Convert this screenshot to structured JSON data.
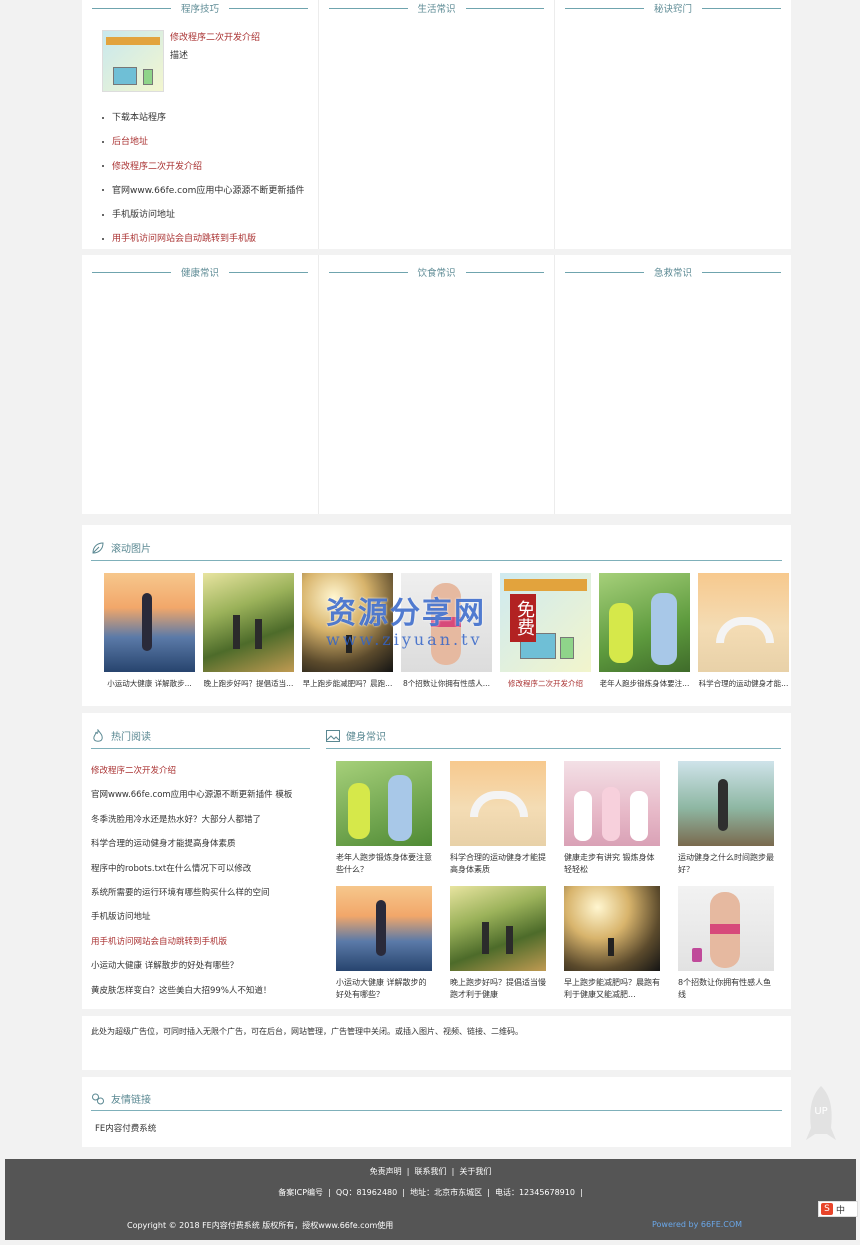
{
  "top_panel": {
    "columns": [
      {
        "title": "程序技巧"
      },
      {
        "title": "生活常识"
      },
      {
        "title": "秘诀窍门"
      }
    ],
    "featured": {
      "title": "修改程序二次开发介绍",
      "desc": "描述"
    },
    "links": [
      {
        "text": "下载本站程序",
        "red": false
      },
      {
        "text": "后台地址",
        "red": true
      },
      {
        "text": "修改程序二次开发介绍",
        "red": true
      },
      {
        "text": "官网www.66fe.com应用中心源源不断更新插件",
        "red": false
      },
      {
        "text": "手机版访问地址",
        "red": false
      },
      {
        "text": "用手机访问网站会自动跳转到手机版",
        "red": true
      }
    ]
  },
  "second_panel": {
    "columns": [
      {
        "title": "健康常识"
      },
      {
        "title": "饮食常识"
      },
      {
        "title": "急救常识"
      }
    ]
  },
  "scroll_section": {
    "title": "滚动图片",
    "items": [
      {
        "caption": "小运动大健康 详解散步...",
        "red": false
      },
      {
        "caption": "晚上跑步好吗？提倡适当...",
        "red": false
      },
      {
        "caption": "早上跑步能减肥吗？晨跑...",
        "red": false
      },
      {
        "caption": "8个招数让你拥有性感人...",
        "red": false
      },
      {
        "caption": "修改程序二次开发介绍",
        "red": true
      },
      {
        "caption": "老年人跑步锻炼身体要注...",
        "red": false
      },
      {
        "caption": "科学合理的运动健身才能...",
        "red": false
      }
    ]
  },
  "watermark": {
    "main": "资源分享网",
    "sub": "www.ziyuan.tv",
    "badge": "免费"
  },
  "hot_reading": {
    "title": "热门阅读",
    "items": [
      {
        "text": "修改程序二次开发介绍",
        "red": true
      },
      {
        "text": "官网www.66fe.com应用中心源源不断更新插件 模板",
        "red": false
      },
      {
        "text": "冬季洗脸用冷水还是热水好？大部分人都错了",
        "red": false
      },
      {
        "text": "科学合理的运动健身才能提高身体素质",
        "red": false
      },
      {
        "text": "程序中的robots.txt在什么情况下可以修改",
        "red": false
      },
      {
        "text": "系统所需要的运行环境有哪些购买什么样的空间",
        "red": false
      },
      {
        "text": "手机版访问地址",
        "red": false
      },
      {
        "text": "用手机访问网站会自动跳转到手机版",
        "red": true
      },
      {
        "text": "小运动大健康 详解散步的好处有哪些？",
        "red": false
      },
      {
        "text": "黄皮肤怎样变白？这些美白大招99%人不知道！",
        "red": false
      }
    ]
  },
  "fitness": {
    "title": "健身常识",
    "items": [
      {
        "caption": "老年人跑步锻炼身体要注意些什么？"
      },
      {
        "caption": "科学合理的运动健身才能提高身体素质"
      },
      {
        "caption": "健康走步有讲究 锻炼身体轻轻松"
      },
      {
        "caption": "运动健身之什么时间跑步最好？"
      },
      {
        "caption": "小运动大健康 详解散步的好处有哪些？"
      },
      {
        "caption": "晚上跑步好吗？提倡适当慢跑才利于健康"
      },
      {
        "caption": "早上跑步能减肥吗？晨跑有利于健康又能减肥..."
      },
      {
        "caption": "8个招数让你拥有性感人鱼线"
      }
    ]
  },
  "ad_text": "此处为超级广告位，可同时插入无限个广告，可在后台，网站管理，广告管理中关闭。或插入图片、视频、链接、二维码。",
  "friend_links": {
    "title": "友情链接",
    "items": [
      "FE内容付费系统"
    ]
  },
  "up_button": {
    "label": "UP"
  },
  "footer": {
    "nav": [
      "免责声明",
      "联系我们",
      "关于我们"
    ],
    "icp": "备案ICP编号",
    "qq": "QQ：81962480",
    "address": "地址：北京市东城区",
    "phone": "电话：12345678910",
    "copyright": "Copyright © 2018 FE内容付费系统 版权所有，授权www.66fe.com使用",
    "powered": "Powered by 66FE.COM"
  },
  "ime_badge": {
    "letter": "S",
    "label": "中"
  }
}
